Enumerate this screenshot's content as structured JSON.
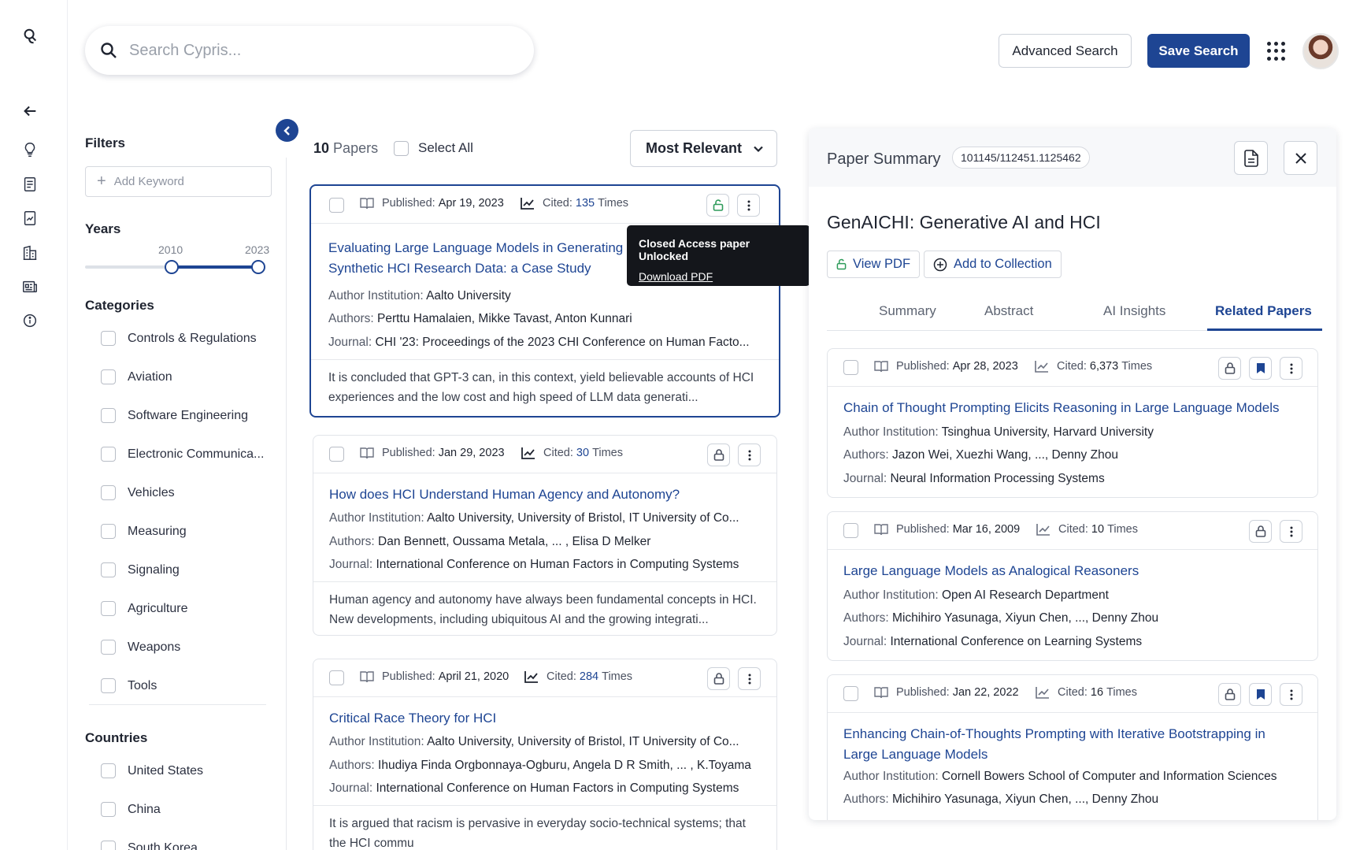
{
  "header": {
    "search_placeholder": "Search Cypris...",
    "advanced_search": "Advanced Search",
    "save_search": "Save Search"
  },
  "filters": {
    "title": "Filters",
    "add_keyword": "Add Keyword",
    "years_title": "Years",
    "year_from": "2010",
    "year_to": "2023",
    "categories_title": "Categories",
    "categories": [
      "Controls & Regulations",
      "Aviation",
      "Software Engineering",
      "Electronic Communica...",
      "Vehicles",
      "Measuring",
      "Signaling",
      "Agriculture",
      "Weapons",
      "Tools"
    ],
    "countries_title": "Countries",
    "countries": [
      "United States",
      "China",
      "South Korea"
    ]
  },
  "results": {
    "count": "10",
    "count_label": "Papers",
    "select_all": "Select All",
    "sort": "Most Relevant"
  },
  "labels": {
    "published": "Published:",
    "cited": "Cited:",
    "times": "Times",
    "author_institution": "Author Institution:",
    "authors": "Authors:",
    "journal": "Journal:"
  },
  "papers": [
    {
      "published": "Apr 19, 2023",
      "cited": "135",
      "title": "Evaluating Large Language Models in Generating Synthetic HCI Research Data: a Case Study",
      "institution": "Aalto University",
      "authors": "Perttu Hamalaien, Mikke Tavast, Anton Kunnari",
      "journal": "CHI '23: Proceedings of the 2023 CHI Conference on Human Facto...",
      "abstract": "It is concluded that GPT-3 can, in this context, yield believable accounts of HCI experiences and the low cost and high speed of LLM data generati..."
    },
    {
      "published": "Jan 29, 2023",
      "cited": "30",
      "title": "How does HCI Understand Human Agency and Autonomy?",
      "institution": "Aalto University, University of Bristol,  IT University of Co...",
      "authors": "Dan Bennett, Oussama Metala, ... , Elisa D Melker",
      "journal": "International Conference on Human Factors in Computing Systems",
      "abstract": "Human agency and autonomy have always been fundamental concepts in HCI. New developments, including ubiquitous AI and the growing integrati..."
    },
    {
      "published": "April 21, 2020",
      "cited": "284",
      "title": "Critical Race Theory for HCI",
      "institution": "Aalto University, University of Bristol,  IT University of Co...",
      "authors": "Ihudiya Finda Orgbonnaya-Ogburu, Angela D R Smith, ... , K.Toyama",
      "journal": "International Conference on Human Factors in Computing Systems",
      "abstract": "It is argued that racism is pervasive in everyday socio-technical systems; that the HCI commu"
    }
  ],
  "tooltip": {
    "title": "Closed Access paper Unlocked",
    "link": "Download PDF"
  },
  "summary": {
    "title": "Paper Summary",
    "doi": "101145/112451.1125462",
    "paper_title": "GenAICHI: Generative AI and HCI",
    "view_pdf": "View PDF",
    "add_collection": "Add to Collection",
    "tabs": [
      "Summary",
      "Abstract",
      "AI Insights",
      "Related Papers"
    ],
    "active_tab": "Related Papers"
  },
  "related": [
    {
      "published": "Apr 28, 2023",
      "cited": "6,373",
      "title": "Chain of Thought Prompting Elicits Reasoning in Large Language Models",
      "institution": "Tsinghua University, Harvard University",
      "authors": "Jazon Wei, Xuezhi Wang, ..., Denny Zhou",
      "journal": "Neural Information Processing Systems"
    },
    {
      "published": "Mar 16, 2009",
      "cited": "10",
      "title": "Large Language Models as Analogical Reasoners",
      "institution": "Open AI Research Department",
      "authors": "Michihiro Yasunaga, Xiyun Chen, ..., Denny Zhou",
      "journal": "International Conference on Learning Systems"
    },
    {
      "published": "Jan 22, 2022",
      "cited": "16",
      "title": "Enhancing Chain-of-Thoughts Prompting with Iterative Bootstrapping in Large Language Models",
      "institution": "Cornell Bowers School of Computer and Information Sciences",
      "authors": "Michihiro Yasunaga, Xiyun Chen, ..., Denny Zhou"
    }
  ],
  "colors": {
    "brand": "#1e4593",
    "tooltip_bg": "#14161b"
  }
}
